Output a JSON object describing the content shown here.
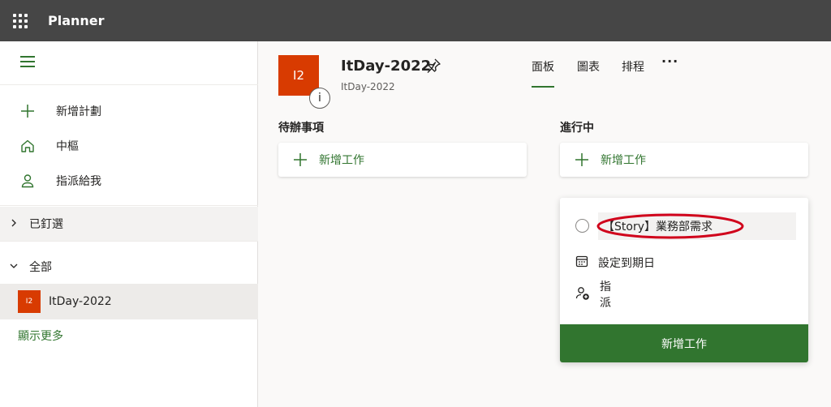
{
  "topbar": {
    "app_name": "Planner"
  },
  "sidebar": {
    "new_plan": "新增計劃",
    "hub": "中樞",
    "assigned_to_me": "指派給我",
    "pinned": "已釘選",
    "all": "全部",
    "plans": [
      {
        "badge": "I2",
        "name": "ItDay-2022"
      }
    ],
    "show_more": "顯示更多"
  },
  "plan": {
    "badge": "I2",
    "title": "ItDay-2022",
    "subtitle": "ItDay-2022",
    "info_glyph": "i",
    "tabs": [
      "面板",
      "圖表",
      "排程"
    ],
    "active_tab": "面板",
    "more": "···"
  },
  "buckets": [
    {
      "title": "待辦事項",
      "add_task_label": "新增工作"
    },
    {
      "title": "進行中",
      "add_task_label": "新增工作"
    }
  ],
  "new_task_card": {
    "title_value": "【Story】業務部需求",
    "due_date_label": "設定到期日",
    "assign_label": "指派",
    "submit_label": "新增工作",
    "highlight_color": "#d0021b"
  },
  "colors": {
    "accent": "#31752f",
    "plan_badge": "#d83b01",
    "topbar": "#464646"
  }
}
